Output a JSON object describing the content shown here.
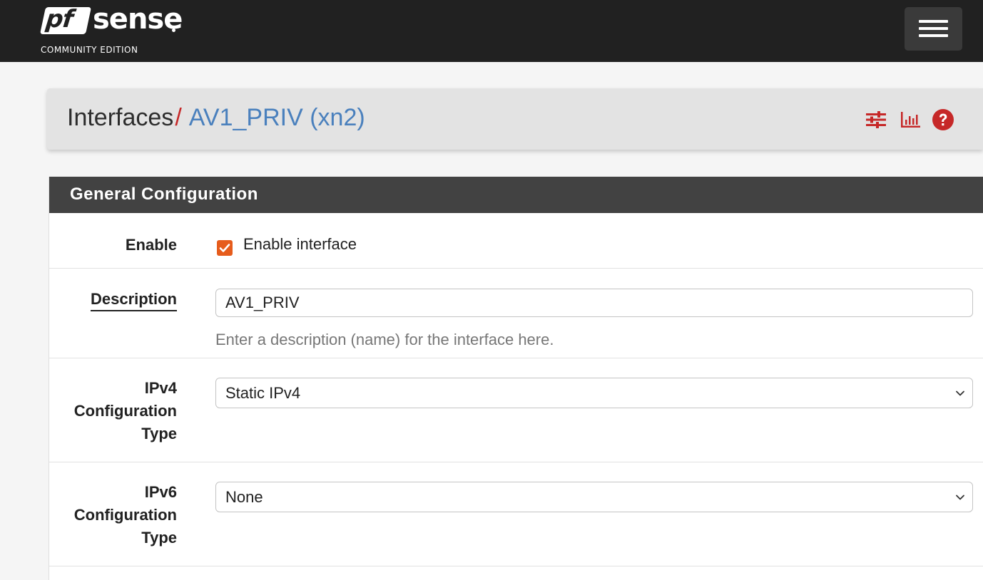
{
  "brand": {
    "logo_pf": "pf",
    "logo_name": "sense",
    "edition": "COMMUNITY EDITION"
  },
  "navbar": {
    "menu_icon": "hamburger-menu-icon"
  },
  "breadcrumb": {
    "parent": "Interfaces",
    "separator": "/",
    "current": "AV1_PRIV (xn2)",
    "icons": [
      "sliders-icon",
      "bar-chart-icon",
      "help-icon"
    ]
  },
  "panel": {
    "title": "General Configuration",
    "rows": {
      "enable": {
        "label": "Enable",
        "checkbox_label": "Enable interface",
        "checked": true
      },
      "description": {
        "label": "Description",
        "value": "AV1_PRIV",
        "help": "Enter a description (name) for the interface here."
      },
      "ipv4": {
        "label_line1": "IPv4",
        "label_line2": "Configuration",
        "label_line3": "Type",
        "selected": "Static IPv4"
      },
      "ipv6": {
        "label_line1": "IPv6",
        "label_line2": "Configuration",
        "label_line3": "Type",
        "selected": "None"
      }
    }
  },
  "colors": {
    "navbar_bg": "#212121",
    "accent_red": "#c62828",
    "link_blue": "#4a80bd",
    "checkbox_orange": "#e65c1c",
    "panel_heading_bg": "#424242"
  }
}
